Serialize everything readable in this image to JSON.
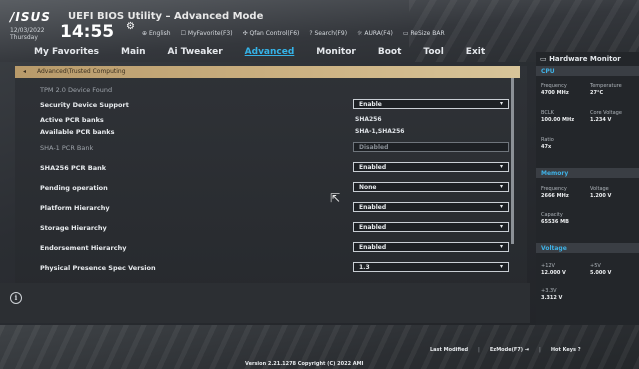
{
  "header": {
    "logo": "/ISUS",
    "title": "UEFI BIOS Utility – Advanced Mode",
    "date": "12/03/2022",
    "weekday": "Thursday",
    "time": "14:55",
    "toolbar": [
      "English",
      "MyFavorite(F3)",
      "Qfan Control(F6)",
      "Search(F9)",
      "AURA(F4)",
      "ReSize BAR"
    ]
  },
  "nav": {
    "tabs": [
      "My Favorites",
      "Main",
      "Ai Tweaker",
      "Advanced",
      "Monitor",
      "Boot",
      "Tool",
      "Exit"
    ],
    "active": "Advanced"
  },
  "breadcrumb": "Advanced\\Trusted Computing",
  "settings": [
    {
      "label": "TPM 2.0 Device Found",
      "value": "",
      "kind": "dim"
    },
    {
      "label": "Security Device Support",
      "value": "Enable",
      "kind": "select"
    },
    {
      "label": "Active PCR banks",
      "value": "SHA256",
      "kind": "text"
    },
    {
      "label": "Available PCR banks",
      "value": "SHA-1,SHA256",
      "kind": "text"
    },
    {
      "label": "SHA-1 PCR Bank",
      "value": "Disabled",
      "kind": "disabled"
    },
    {
      "label": "SHA256 PCR Bank",
      "value": "Enabled",
      "kind": "select"
    },
    {
      "label": "Pending operation",
      "value": "None",
      "kind": "select"
    },
    {
      "label": "Platform Hierarchy",
      "value": "Enabled",
      "kind": "select"
    },
    {
      "label": "Storage Hierarchy",
      "value": "Enabled",
      "kind": "select"
    },
    {
      "label": "Endorsement Hierarchy",
      "value": "Enabled",
      "kind": "select"
    },
    {
      "label": "Physical Presence Spec Version",
      "value": "1.3",
      "kind": "select"
    }
  ],
  "hardware_monitor": {
    "title": "Hardware Monitor",
    "sections": {
      "cpu": "CPU",
      "memory": "Memory",
      "voltage": "Voltage"
    },
    "cpu": [
      {
        "k": "Frequency",
        "v": "4700 MHz"
      },
      {
        "k": "Temperature",
        "v": "27°C"
      },
      {
        "k": "BCLK",
        "v": "100.00 MHz"
      },
      {
        "k": "Core Voltage",
        "v": "1.234 V"
      },
      {
        "k": "Ratio",
        "v": "47x"
      }
    ],
    "memory": [
      {
        "k": "Frequency",
        "v": "2666 MHz"
      },
      {
        "k": "Voltage",
        "v": "1.200 V"
      },
      {
        "k": "Capacity",
        "v": "65536 MB"
      }
    ],
    "voltage": [
      {
        "k": "+12V",
        "v": "12.000 V"
      },
      {
        "k": "+5V",
        "v": "5.000 V"
      },
      {
        "k": "+3.3V",
        "v": "3.312 V"
      }
    ]
  },
  "footer": {
    "version": "Version 2.21.1278 Copyright (C) 2022 AMI",
    "last_modified": "Last Modified",
    "ezmode": "EzMode(F7)",
    "hotkeys": "Hot Keys"
  },
  "colors": {
    "accent": "#35b3e8",
    "breadcrumb": "#cdb384"
  }
}
